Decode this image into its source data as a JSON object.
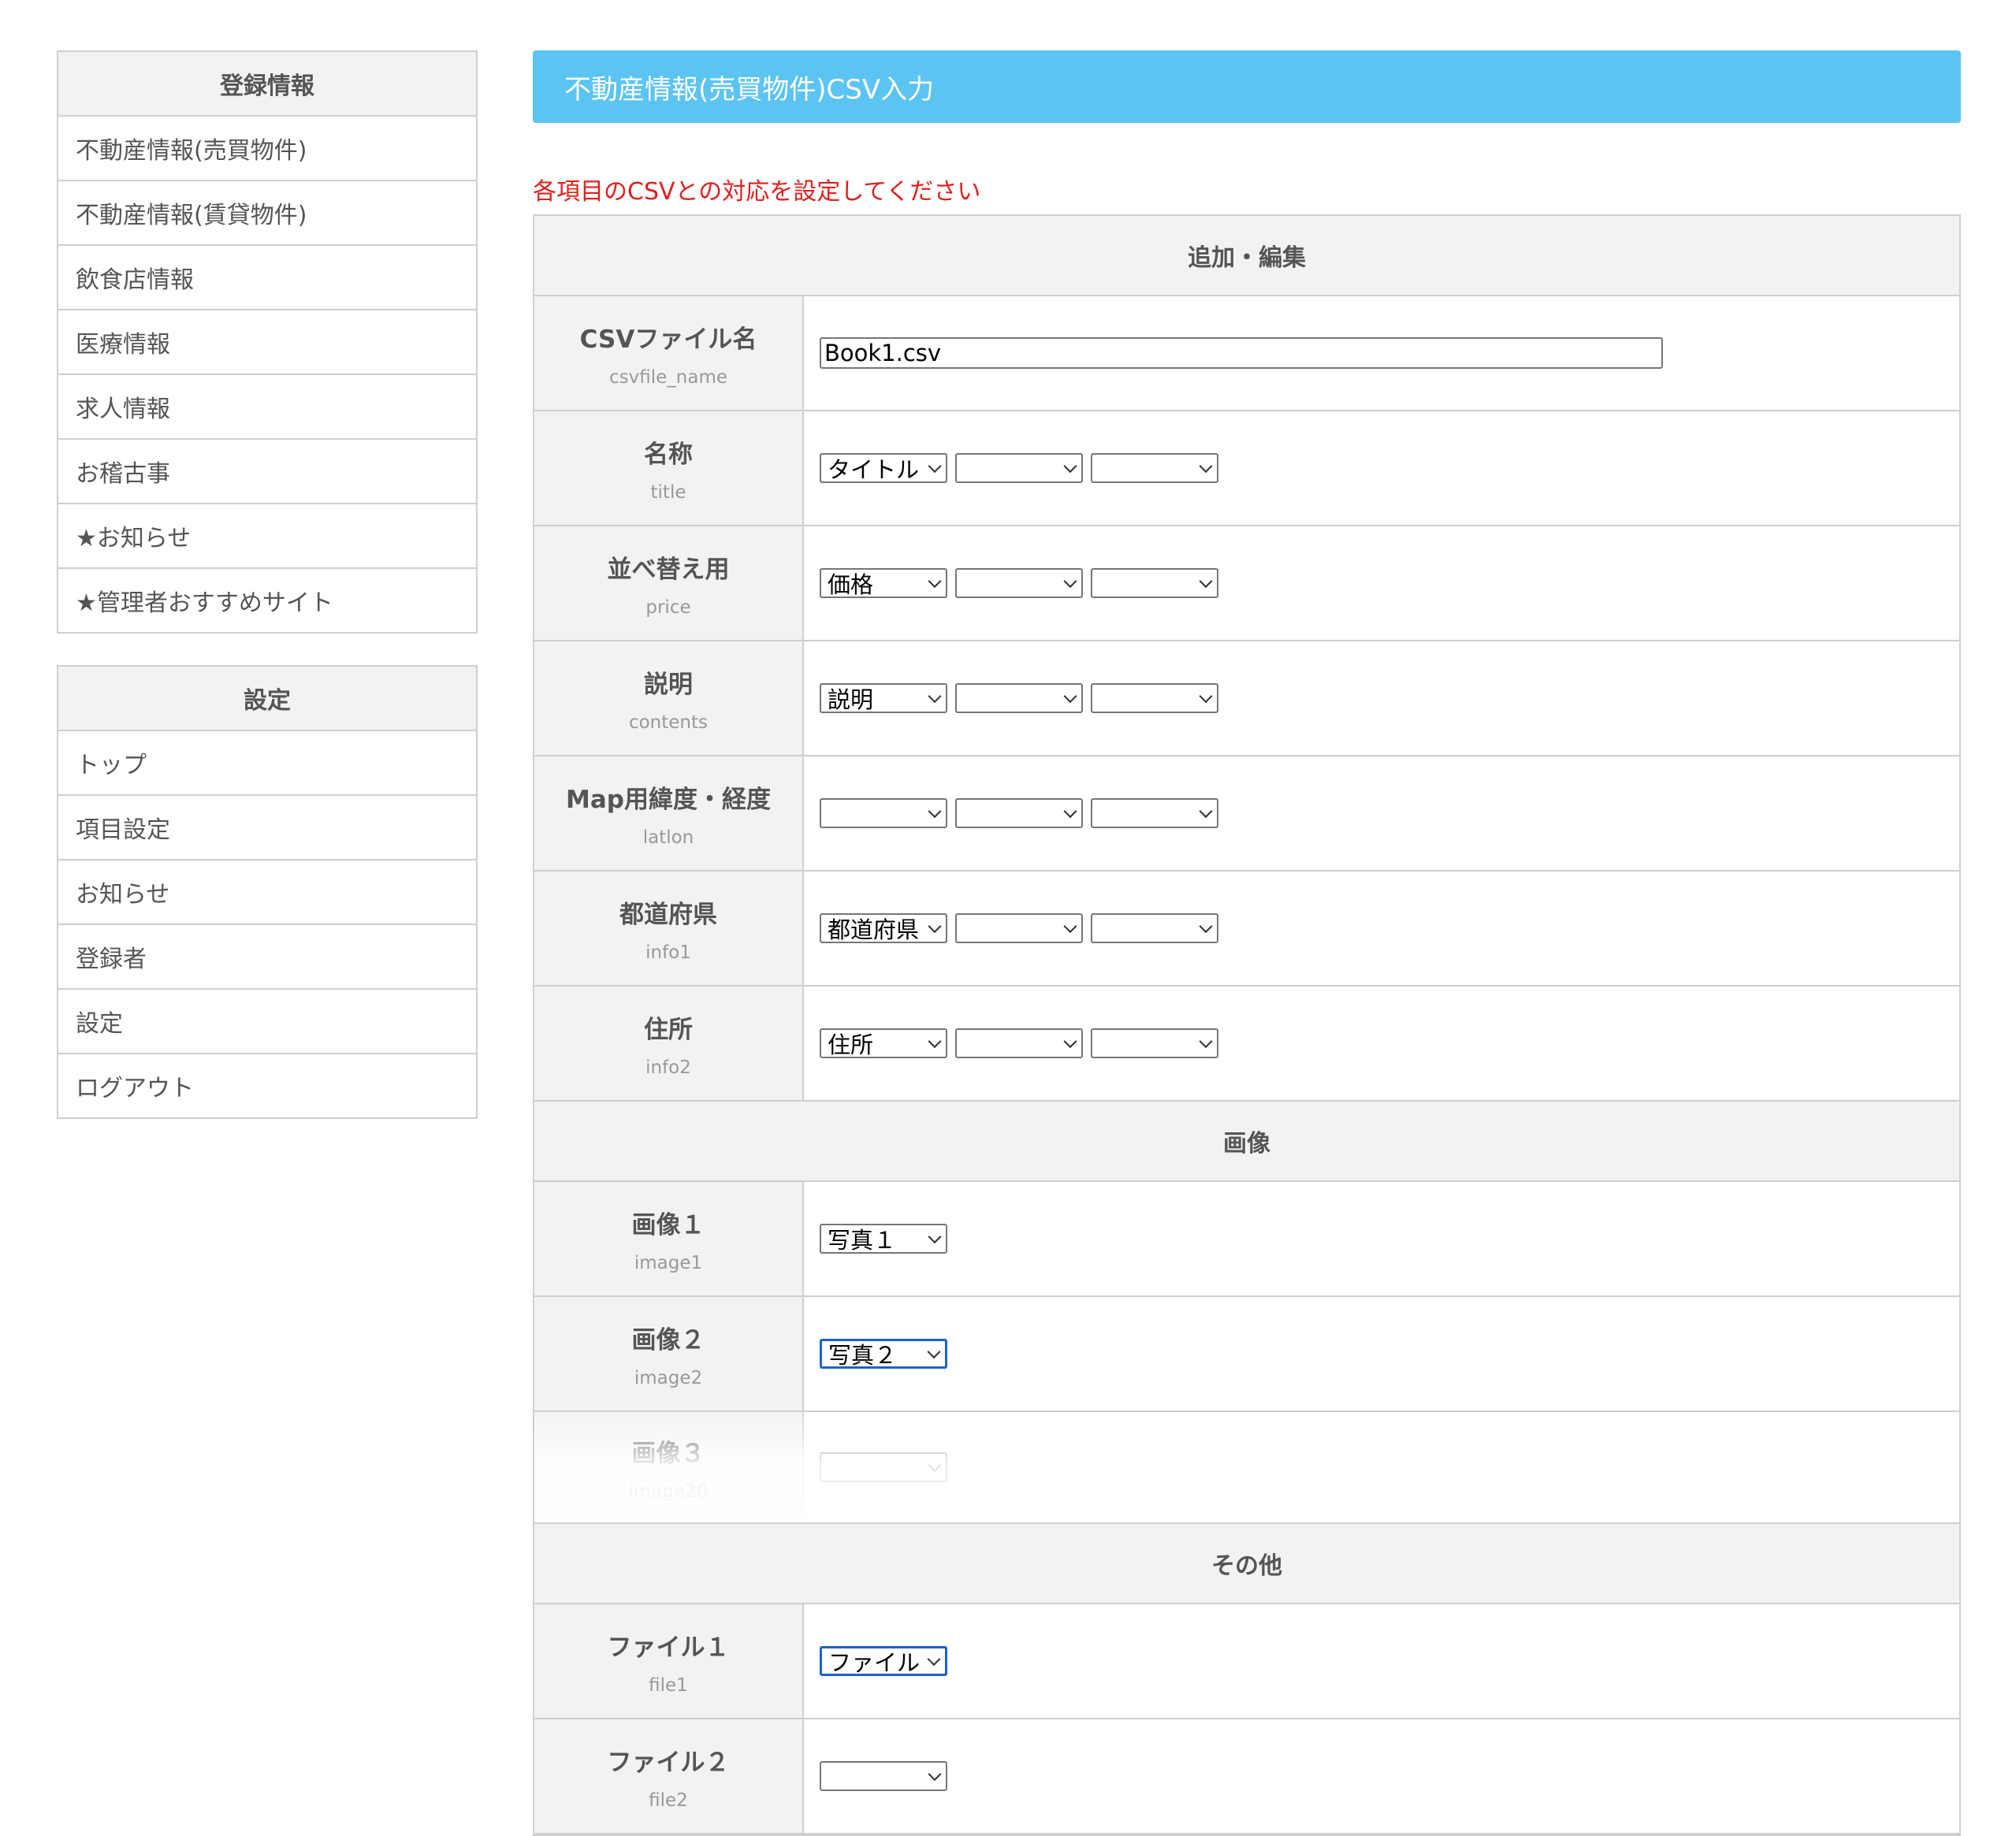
{
  "sidebar": {
    "registration": {
      "header": "登録情報",
      "items": [
        "不動産情報(売買物件)",
        "不動産情報(賃貸物件)",
        "飲食店情報",
        "医療情報",
        "求人情報",
        "お稽古事",
        "★お知らせ",
        "★管理者おすすめサイト"
      ]
    },
    "settings": {
      "header": "設定",
      "items": [
        "トップ",
        "項目設定",
        "お知らせ",
        "登録者",
        "設定",
        "ログアウト"
      ]
    }
  },
  "page": {
    "title": "不動産情報(売買物件)CSV入力",
    "instruction": "各項目のCSVとの対応を設定してください"
  },
  "colors": {
    "banner": "#5bc4f3",
    "instruction": "#e0201d",
    "focus_border": "#1a62d0"
  },
  "sections": {
    "add_edit": {
      "header": "追加・編集",
      "csvfile": {
        "label": "CSVファイル名",
        "sub": "csvfile_name",
        "value": "Book1.csv"
      },
      "rows": [
        {
          "label": "名称",
          "sub": "title",
          "selects": [
            "タイトル",
            "",
            ""
          ]
        },
        {
          "label": "並べ替え用",
          "sub": "price",
          "selects": [
            "価格",
            "",
            ""
          ]
        },
        {
          "label": "説明",
          "sub": "contents",
          "selects": [
            "説明",
            "",
            ""
          ]
        },
        {
          "label": "Map用緯度・経度",
          "sub": "latlon",
          "selects": [
            "",
            "",
            ""
          ]
        },
        {
          "label": "都道府県",
          "sub": "info1",
          "selects": [
            "都道府県",
            "",
            ""
          ]
        },
        {
          "label": "住所",
          "sub": "info2",
          "selects": [
            "住所",
            "",
            ""
          ]
        }
      ]
    },
    "images": {
      "header": "画像",
      "rows": [
        {
          "label": "画像１",
          "sub": "image1",
          "value": "写真１"
        },
        {
          "label": "画像２",
          "sub": "image2",
          "value": "写真２"
        },
        {
          "label": "画像３",
          "sub": "image20",
          "value": ""
        }
      ]
    },
    "other": {
      "header": "その他",
      "rows": [
        {
          "label": "ファイル１",
          "sub": "file1",
          "value": "ファイル"
        },
        {
          "label": "ファイル２",
          "sub": "file2",
          "value": ""
        }
      ]
    }
  }
}
